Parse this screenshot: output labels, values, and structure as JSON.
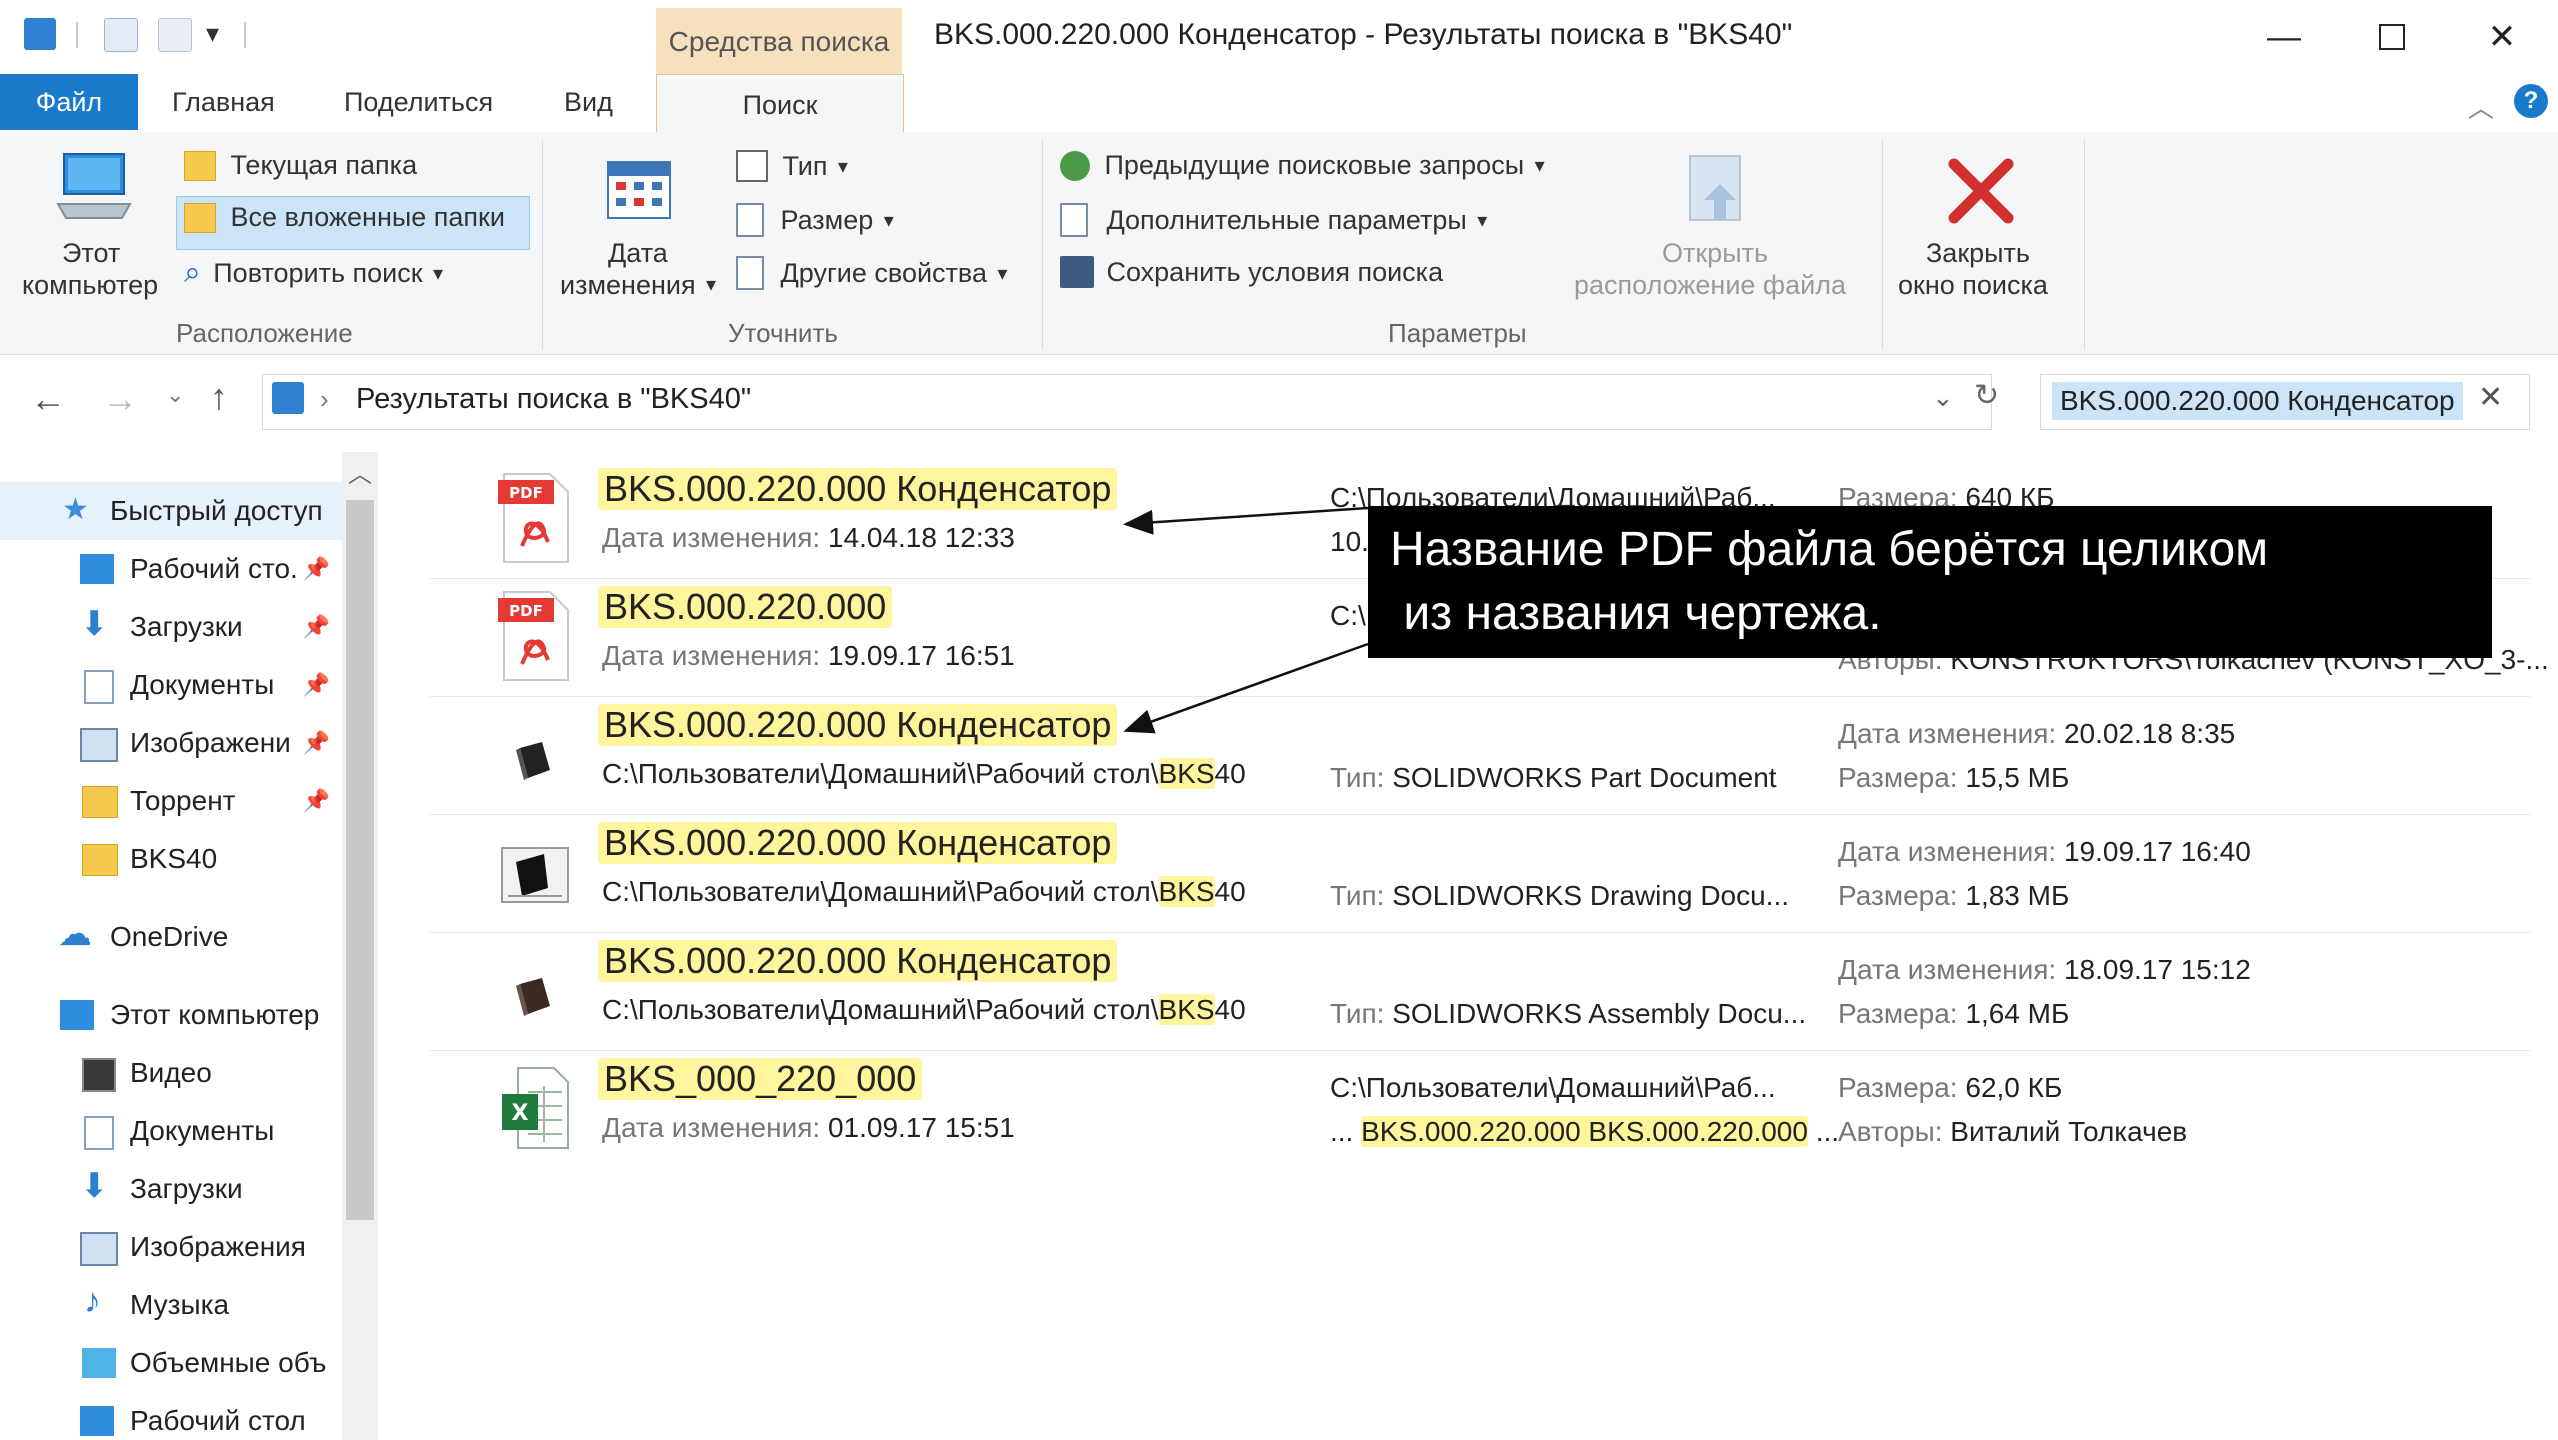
{
  "window": {
    "context_tab": "Средства поиска",
    "title": "BKS.000.220.000 Конденсатор - Результаты поиска в \"BKS40\""
  },
  "tabs": {
    "file": "Файл",
    "home": "Главная",
    "share": "Поделиться",
    "view": "Вид",
    "search": "Поиск"
  },
  "ribbon": {
    "location": {
      "this_pc_line1": "Этот",
      "this_pc_line2": "компьютер",
      "current_folder": "Текущая папка",
      "all_subfolders": "Все вложенные папки",
      "search_again": "Повторить поиск",
      "group": "Расположение"
    },
    "refine": {
      "date_line1": "Дата",
      "date_line2": "изменения",
      "type": "Тип",
      "size": "Размер",
      "other_props": "Другие свойства",
      "group": "Уточнить"
    },
    "options": {
      "recent": "Предыдущие поисковые запросы",
      "advanced": "Дополнительные параметры",
      "save": "Сохранить условия поиска",
      "group": "Параметры"
    },
    "open_loc_line1": "Открыть",
    "open_loc_line2": "расположение файла",
    "close_line1": "Закрыть",
    "close_line2": "окно поиска"
  },
  "address": {
    "path": "Результаты поиска в \"BKS40\"",
    "search_query": "BKS.000.220.000 Конденсатор"
  },
  "nav": [
    {
      "label": "Быстрый доступ",
      "icon": "star-icon",
      "pinned": false
    },
    {
      "label": "Рабочий сто.",
      "icon": "desktop-icon",
      "pinned": true
    },
    {
      "label": "Загрузки",
      "icon": "download-icon",
      "pinned": true
    },
    {
      "label": "Документы",
      "icon": "document-icon",
      "pinned": true
    },
    {
      "label": "Изображени",
      "icon": "pictures-icon",
      "pinned": true
    },
    {
      "label": "Торрент",
      "icon": "folder-icon",
      "pinned": true
    },
    {
      "label": "BKS40",
      "icon": "folder-icon",
      "pinned": false
    },
    {
      "label": "OneDrive",
      "icon": "cloud-icon",
      "pinned": false
    },
    {
      "label": "Этот компьютер",
      "icon": "computer-icon",
      "pinned": false
    },
    {
      "label": "Видео",
      "icon": "video-icon",
      "pinned": false
    },
    {
      "label": "Документы",
      "icon": "document-icon",
      "pinned": false
    },
    {
      "label": "Загрузки",
      "icon": "download-icon",
      "pinned": false
    },
    {
      "label": "Изображения",
      "icon": "pictures-icon",
      "pinned": false
    },
    {
      "label": "Музыка",
      "icon": "music-icon",
      "pinned": false
    },
    {
      "label": "Объемные объ",
      "icon": "3d-objects-icon",
      "pinned": false
    },
    {
      "label": "Рабочий стол",
      "icon": "desktop-icon",
      "pinned": false
    }
  ],
  "results": [
    {
      "name": "BKS.000.220.000 Конденсатор",
      "icon": "pdf-icon",
      "date_label": "Дата изменения:",
      "date": "14.04.18 12:33",
      "path": "C:\\Пользователи\\Домашний\\Раб...",
      "path2": "10...",
      "size_label": "Размера:",
      "size": "640 КБ"
    },
    {
      "name": "BKS.000.220.000",
      "icon": "pdf-icon",
      "date_label": "Дата изменения:",
      "date": "19.09.17 16:51",
      "path": "C:\\",
      "authors_label": "Авторы:",
      "authors": "KONSTRUKTORS\\Tolkachev (KONST_XO_3-..."
    },
    {
      "name": "BKS.000.220.000 Конденсатор",
      "icon": "solidworks-part-icon",
      "path_prefix": "C:\\Пользователи\\Домашний\\Рабочий стол\\",
      "path_hl": "BKS",
      "path_suffix": "40",
      "type_label": "Тип:",
      "type": "SOLIDWORKS Part Document",
      "date_label": "Дата изменения:",
      "date": "20.02.18 8:35",
      "size_label": "Размера:",
      "size": "15,5 МБ"
    },
    {
      "name": "BKS.000.220.000 Конденсатор",
      "icon": "solidworks-drawing-icon",
      "path_prefix": "C:\\Пользователи\\Домашний\\Рабочий стол\\",
      "path_hl": "BKS",
      "path_suffix": "40",
      "type_label": "Тип:",
      "type": "SOLIDWORKS Drawing Docu...",
      "date_label": "Дата изменения:",
      "date": "19.09.17 16:40",
      "size_label": "Размера:",
      "size": "1,83 МБ"
    },
    {
      "name": "BKS.000.220.000 Конденсатор",
      "icon": "solidworks-assembly-icon",
      "path_prefix": "C:\\Пользователи\\Домашний\\Рабочий стол\\",
      "path_hl": "BKS",
      "path_suffix": "40",
      "type_label": "Тип:",
      "type": "SOLIDWORKS Assembly Docu...",
      "date_label": "Дата изменения:",
      "date": "18.09.17 15:12",
      "size_label": "Размера:",
      "size": "1,64 МБ"
    },
    {
      "name": "BKS_000_220_000",
      "icon": "excel-icon",
      "date_label": "Дата изменения:",
      "date": "01.09.17 15:51",
      "path": "C:\\Пользователи\\Домашний\\Раб...",
      "path2_prefix": "...",
      "path2_hl": "BKS.000.220.000 BKS.000.220.000",
      "path2_suffix": "...",
      "size_label": "Размера:",
      "size": "62,0 КБ",
      "authors_label": "Авторы:",
      "authors": "Виталий Толкачев"
    }
  ],
  "annotation": {
    "text": "Название PDF файла берётся целиком\n из названия чертежа."
  },
  "colors": {
    "accent": "#1979ca",
    "highlight": "#fff59d",
    "context_tab": "#f6e0bd",
    "close_x": "#d32f2f"
  }
}
